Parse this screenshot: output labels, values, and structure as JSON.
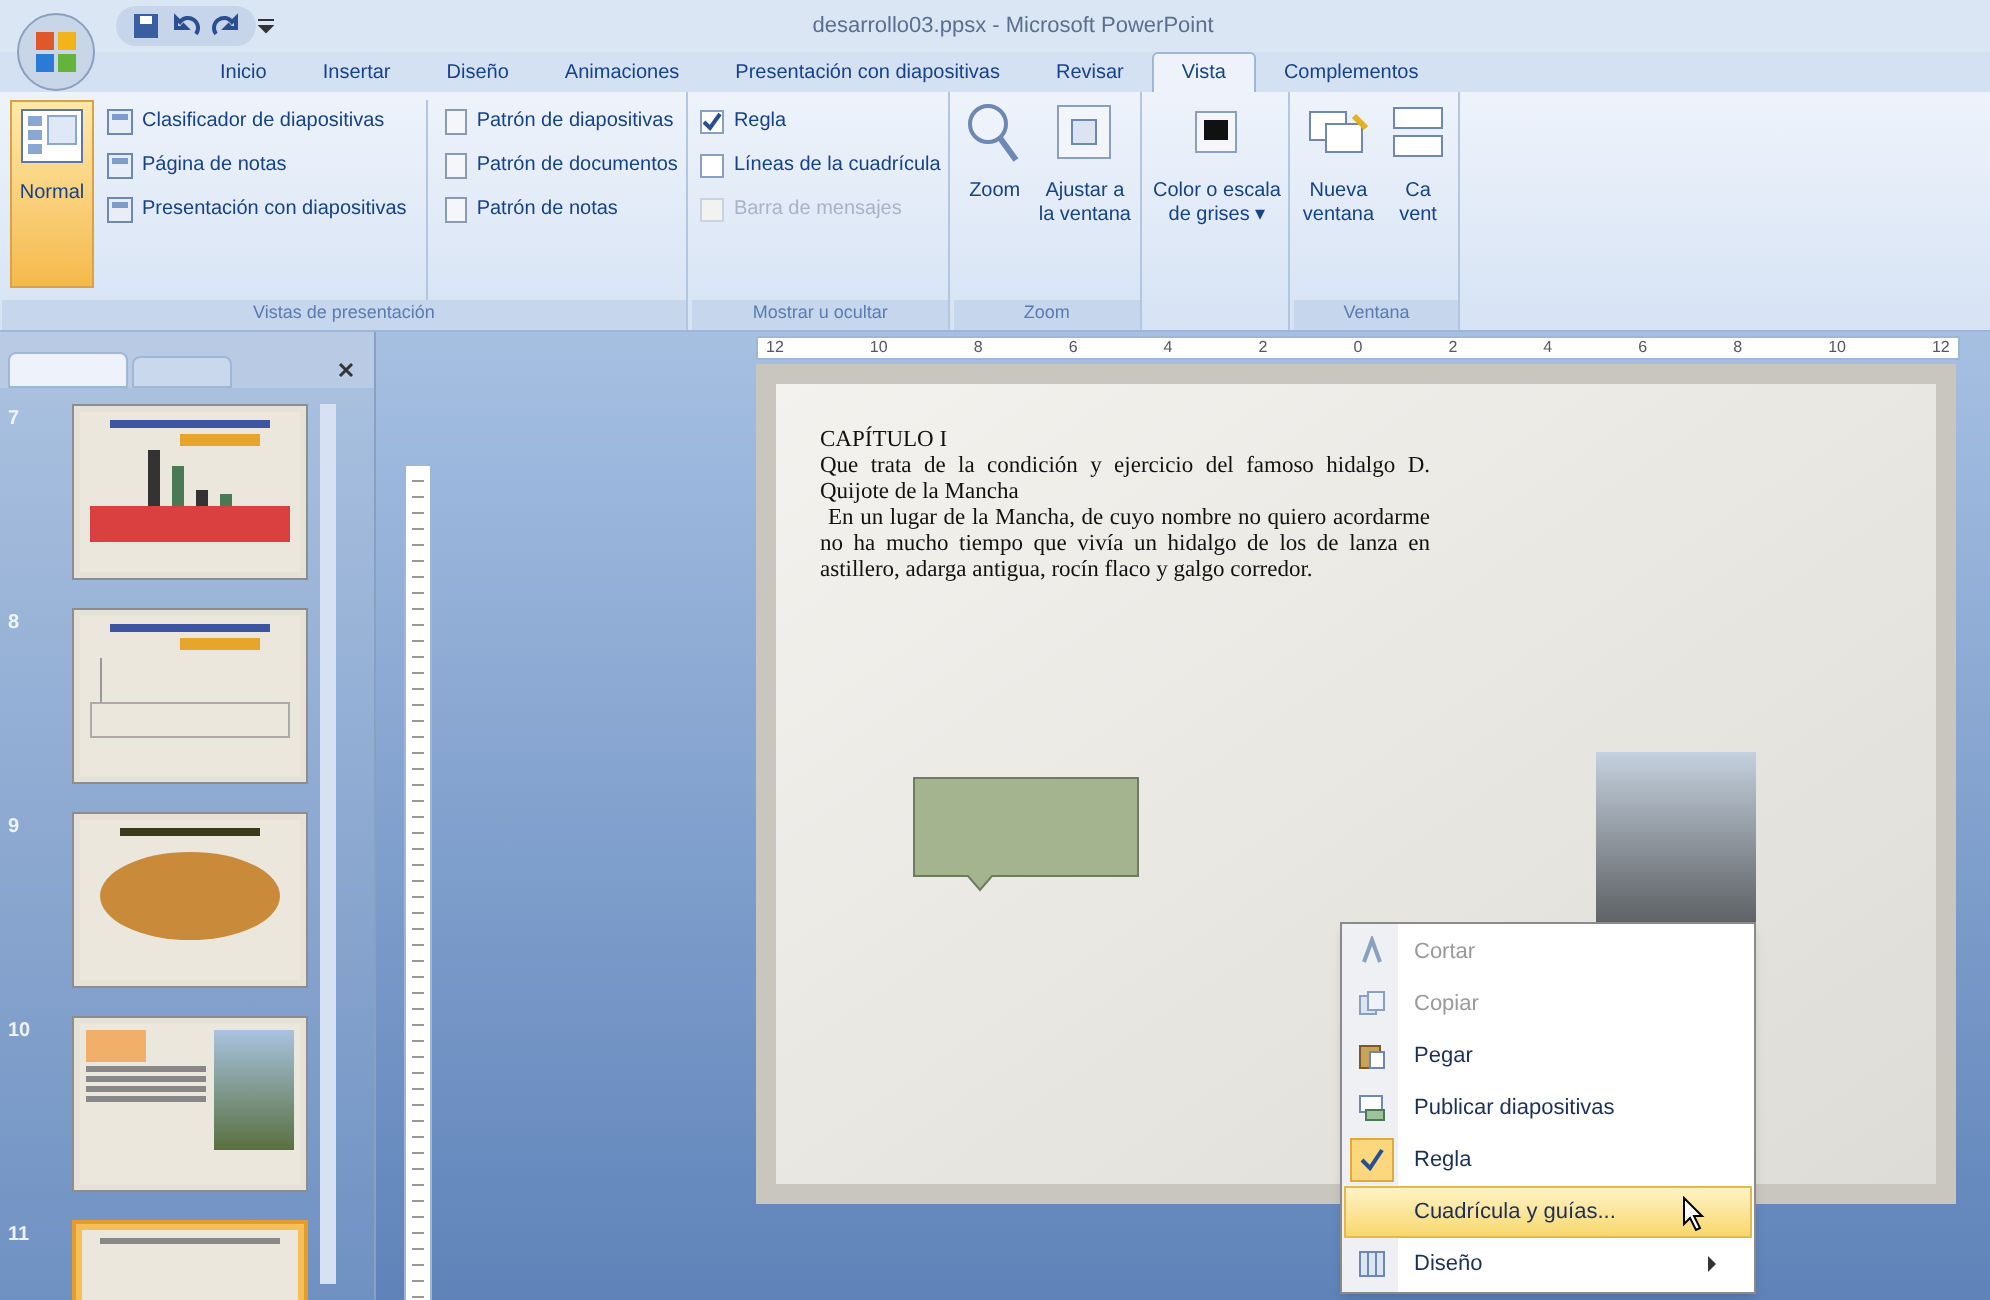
{
  "window": {
    "title": "desarrollo03.ppsx - Microsoft PowerPoint"
  },
  "tabs": [
    {
      "label": "Inicio",
      "selected": false
    },
    {
      "label": "Insertar",
      "selected": false
    },
    {
      "label": "Diseño",
      "selected": false
    },
    {
      "label": "Animaciones",
      "selected": false
    },
    {
      "label": "Presentación con diapositivas",
      "selected": false
    },
    {
      "label": "Revisar",
      "selected": false
    },
    {
      "label": "Vista",
      "selected": true
    },
    {
      "label": "Complementos",
      "selected": false
    }
  ],
  "ribbon": {
    "views": {
      "label": "Vistas de presentación",
      "normal": {
        "label": "Normal",
        "selected": true
      },
      "items": [
        {
          "label": "Clasificador de diapositivas"
        },
        {
          "label": "Página de notas"
        },
        {
          "label": "Presentación con diapositivas"
        }
      ],
      "masters": [
        {
          "label": "Patrón de diapositivas"
        },
        {
          "label": "Patrón de documentos"
        },
        {
          "label": "Patrón de notas"
        }
      ]
    },
    "show": {
      "label": "Mostrar u ocultar",
      "items": [
        {
          "label": "Regla",
          "checked": true,
          "disabled": false
        },
        {
          "label": "Líneas de la cuadrícula",
          "checked": false,
          "disabled": false
        },
        {
          "label": "Barra de mensajes",
          "checked": false,
          "disabled": true
        }
      ]
    },
    "zoom": {
      "label": "Zoom",
      "buttons": [
        {
          "kind": "zoom",
          "lines": [
            "Zoom"
          ]
        },
        {
          "kind": "fit",
          "lines": [
            "Ajustar a",
            "la ventana"
          ]
        }
      ]
    },
    "color": {
      "button": [
        "Color o escala",
        "de grises ▾"
      ]
    },
    "window_group": {
      "label": "Ventana",
      "buttons": [
        {
          "kind": "new",
          "lines": [
            "Nueva",
            "ventana"
          ]
        },
        {
          "kind": "cut",
          "lines": [
            "Ca",
            "vent"
          ]
        }
      ]
    }
  },
  "slides_panel": {
    "slides": [
      {
        "number": "7",
        "kind": "chart",
        "selected": false
      },
      {
        "number": "8",
        "kind": "table",
        "selected": false
      },
      {
        "number": "9",
        "kind": "pie",
        "selected": false
      },
      {
        "number": "10",
        "kind": "photo",
        "selected": false
      },
      {
        "number": "11",
        "kind": "text",
        "selected": true
      }
    ]
  },
  "ruler": {
    "ticks": [
      "12",
      "10",
      "8",
      "6",
      "4",
      "2",
      "0",
      "2",
      "4",
      "6",
      "8",
      "10",
      "12"
    ]
  },
  "slide": {
    "heading": "CAPÍTULO I",
    "paragraphs": [
      "Que trata de la condición y ejercicio del famoso hidalgo D. Quijote de la Mancha",
      "En un lugar de la Mancha, de cuyo nombre no quiero acordarme no ha mucho tiempo que vivía un hidalgo de los de lanza en astillero, adarga antigua, rocín flaco y galgo corredor."
    ]
  },
  "context_menu": {
    "items": [
      {
        "label": "Cortar",
        "kind": "cut",
        "disabled": true,
        "checked": false,
        "selected": false,
        "submenu": false
      },
      {
        "label": "Copiar",
        "kind": "copy",
        "disabled": true,
        "checked": false,
        "selected": false,
        "submenu": false
      },
      {
        "label": "Pegar",
        "kind": "paste",
        "disabled": false,
        "checked": false,
        "selected": false,
        "submenu": false
      },
      {
        "label": "Publicar diapositivas",
        "kind": "publish",
        "disabled": false,
        "checked": false,
        "selected": false,
        "submenu": false
      },
      {
        "label": "Regla",
        "disabled": false,
        "checked": true,
        "selected": false,
        "submenu": false
      },
      {
        "label": "Cuadrícula y guías...",
        "disabled": false,
        "checked": false,
        "selected": true,
        "submenu": false
      },
      {
        "label": "Diseño",
        "kind": "layout",
        "disabled": false,
        "checked": false,
        "selected": false,
        "submenu": true
      }
    ]
  }
}
